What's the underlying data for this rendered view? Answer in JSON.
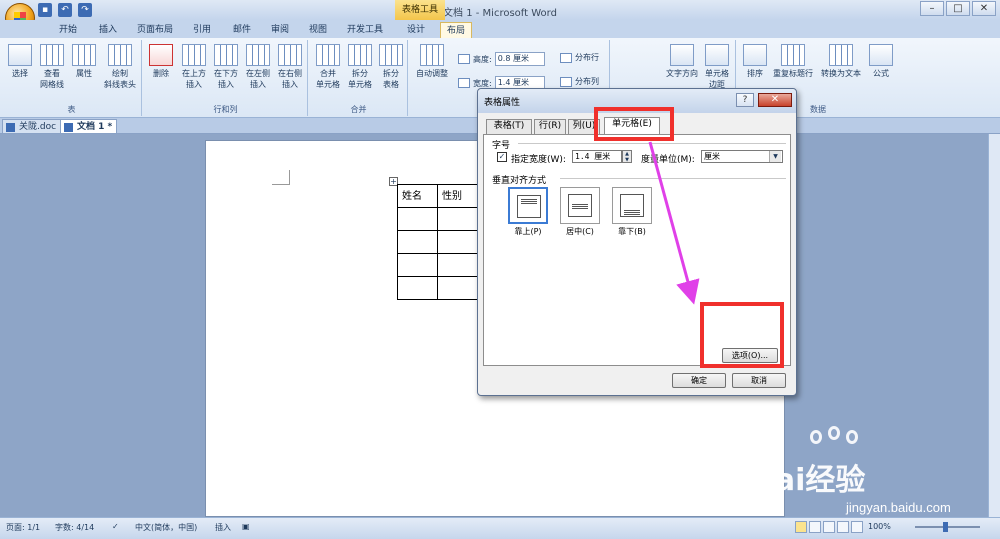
{
  "window": {
    "title": "文档 1 - Microsoft Word",
    "contextual_tab": "表格工具"
  },
  "window_controls": [
    "–",
    "□",
    "✕"
  ],
  "tabs": [
    "开始",
    "插入",
    "页面布局",
    "引用",
    "邮件",
    "审阅",
    "视图",
    "开发工具",
    "设计",
    "布局"
  ],
  "ribbon": {
    "groups": {
      "table": "表",
      "rows_cols": "行和列",
      "merge": "合并",
      "data": "数据"
    },
    "buttons": {
      "select": "选择",
      "view_grid": "查看\n网格线",
      "properties": "属性",
      "draw_diag": "绘制\n斜线表头",
      "delete": "删除",
      "insert_above": "在上方\n插入",
      "insert_below": "在下方\n插入",
      "insert_left": "在左侧\n插入",
      "insert_right": "在右侧\n插入",
      "merge_cells": "合并\n单元格",
      "split_cells": "拆分\n单元格",
      "split_table": "拆分\n表格",
      "autofit": "自动调整",
      "height_label": "高度:",
      "height_value": "0.8 厘米",
      "width_label": "宽度:",
      "width_value": "1.4 厘米",
      "dist_rows": "分布行",
      "dist_cols": "分布列",
      "text_direction": "文字方向",
      "cell_margins": "单元格\n边距",
      "sort": "排序",
      "repeat_header": "重复标题行",
      "convert_text": "转换为文本",
      "formula": "公式"
    }
  },
  "doc_tabs": [
    "关陇.doc",
    "文档 1 *"
  ],
  "table": {
    "headers": [
      "姓名",
      "性别"
    ],
    "empty_rows": 4
  },
  "dialog": {
    "title": "表格属性",
    "help": "?",
    "close": "✕",
    "tabs": [
      "表格(T)",
      "行(R)",
      "列(U)",
      "单元格(E)"
    ],
    "size_section": "字号",
    "specify_width_label": "指定宽度(W):",
    "width_value": "1.4 厘米",
    "unit_label": "度量单位(M):",
    "unit_value": "厘米",
    "valign_section": "垂直对齐方式",
    "align_options": [
      "靠上(P)",
      "居中(C)",
      "靠下(B)"
    ],
    "options_button": "选项(O)...",
    "ok_button": "确定",
    "cancel_button": "取消"
  },
  "status": {
    "page": "页面: 1/1",
    "words": "字数: 4/14",
    "language": "中文(简体，中国)",
    "mode": "插入",
    "zoom": "100%"
  },
  "watermark": {
    "brand": "Bai经验",
    "url": "jingyan.baidu.com"
  },
  "colors": {
    "annotation": "#f0302c",
    "arrow": "#e040e8"
  }
}
